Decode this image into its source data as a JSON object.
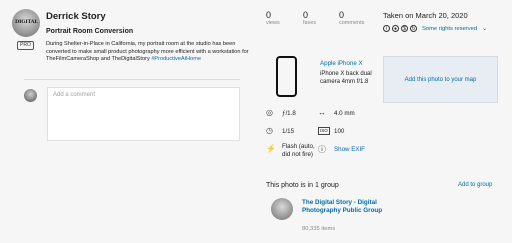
{
  "owner": {
    "name": "Derrick Story",
    "avatar_text": "DIGITAL",
    "badge": "PRO"
  },
  "photo": {
    "title": "Portrait Room Conversion",
    "description_text": "During Shelter-in-Place in California, my portrait room at the studio has been converted to make small product photography more efficient with a workstation for TheFilmCameraShop and TheDigitalStory",
    "hashtag": "#ProductiveAtHome"
  },
  "comment": {
    "placeholder": "Add a comment"
  },
  "stats": [
    {
      "value": "0",
      "label": "views"
    },
    {
      "value": "0",
      "label": "faves"
    },
    {
      "value": "0",
      "label": "comments"
    }
  ],
  "taken": "Taken on March 20, 2020",
  "license": {
    "text": "Some rights reserved",
    "icons": [
      "info-icon",
      "cc-by-icon",
      "cc-nc-icon",
      "cc-sa-icon"
    ]
  },
  "camera": {
    "name": "Apple iPhone X",
    "lens": "iPhone X back dual camera 4mm f/1.8"
  },
  "map": {
    "label": "Add this photo to your map"
  },
  "exif": {
    "aperture": "ƒ/1.8",
    "focal": "4.0 mm",
    "shutter": "1/15",
    "iso": "100",
    "flash": "Flash (auto, did not fire)",
    "show_label": "Show EXIF"
  },
  "groups": {
    "heading": "This photo is in 1 group",
    "add_label": "Add to group",
    "items": [
      {
        "name": "The Digital Story - Digital Photography Public Group",
        "count": "80,335 items"
      }
    ]
  },
  "colors": {
    "link": "#006dac",
    "background": "#f6f6f6"
  }
}
